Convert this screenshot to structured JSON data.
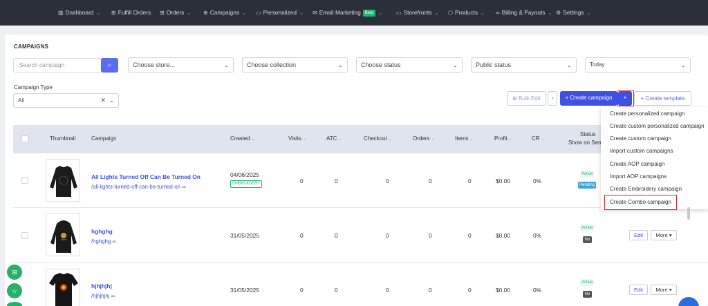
{
  "nav": {
    "items": [
      {
        "label": "Dashboard",
        "icon": "chart-icon"
      },
      {
        "label": "Fulfill Orders",
        "icon": "cart-icon"
      },
      {
        "label": "Orders",
        "icon": "cart-icon"
      },
      {
        "label": "Campaigns",
        "icon": "target-icon"
      },
      {
        "label": "Personalized",
        "icon": "edit-icon"
      },
      {
        "label": "Email Marketing",
        "icon": "mail-icon",
        "badge": "Beta"
      },
      {
        "label": "Storefronts",
        "icon": "store-icon"
      },
      {
        "label": "Products",
        "icon": "box-icon"
      },
      {
        "label": "Billing & Payouts",
        "icon": "card-icon"
      },
      {
        "label": "Settings",
        "icon": "gear-icon"
      }
    ]
  },
  "page": {
    "title": "CAMPAIGNS"
  },
  "filters": {
    "search_placeholder": "Search campaign",
    "store": "Choose store...",
    "collection": "Choose collection",
    "status": "Choose status",
    "public_status": "Public status",
    "date": "Today",
    "type_label": "Campaign Type",
    "type_value": "All"
  },
  "actions": {
    "bulk_edit": "Bulk Edit",
    "create_campaign": "+ Create campaign",
    "create_template": "+ Create template"
  },
  "table": {
    "headers": {
      "thumbnail": "Thumbnail",
      "campaign": "Campaign",
      "created": "Created",
      "visits": "Visits",
      "atc": "ATC",
      "checkout": "Checkout",
      "orders": "Orders",
      "items": "Items",
      "profit": "Profit",
      "cr": "CR",
      "status_line1": "Status",
      "status_line2": "Show on SenP"
    },
    "rows": [
      {
        "name": "All Lights Turned Off Can Be Turned On",
        "slug": "/all-lights-turned-off-can-be-turned-on",
        "created": "04/06/2025",
        "tag": "EMBROIDERY",
        "visits": "0",
        "atc": "0",
        "checkout": "0",
        "orders": "0",
        "items": "0",
        "profit": "$0.00",
        "cr": "0%",
        "status": "Active",
        "show": "Pending"
      },
      {
        "name": "hghghg",
        "slug": "/hghghg",
        "created": "31/05/2025",
        "visits": "0",
        "atc": "0",
        "checkout": "0",
        "orders": "0",
        "items": "0",
        "profit": "$0.00",
        "cr": "0%",
        "status": "Active",
        "show": "No",
        "edit": "Edit",
        "more": "More"
      },
      {
        "name": "hjhjhjhj",
        "slug": "/hjhjhjhj",
        "created": "31/05/2025",
        "visits": "0",
        "atc": "0",
        "checkout": "0",
        "orders": "0",
        "items": "0",
        "profit": "$0.00",
        "cr": "0%",
        "status": "Active",
        "show": "No",
        "edit": "Edit",
        "more": "More"
      }
    ]
  },
  "dropdown": {
    "items": [
      "Create personalized campaign",
      "Create custom personalized campaign",
      "Create custom campaign",
      "Import custom campaigns",
      "Create AOP campaign",
      "Import AOP campaigns",
      "Create Embroidery campaign",
      "Create Combo campaign"
    ]
  },
  "colors": {
    "accent": "#5b6bf0",
    "nav_bg": "#2b2f3a",
    "highlight": "#e02020",
    "success": "#22b573"
  }
}
